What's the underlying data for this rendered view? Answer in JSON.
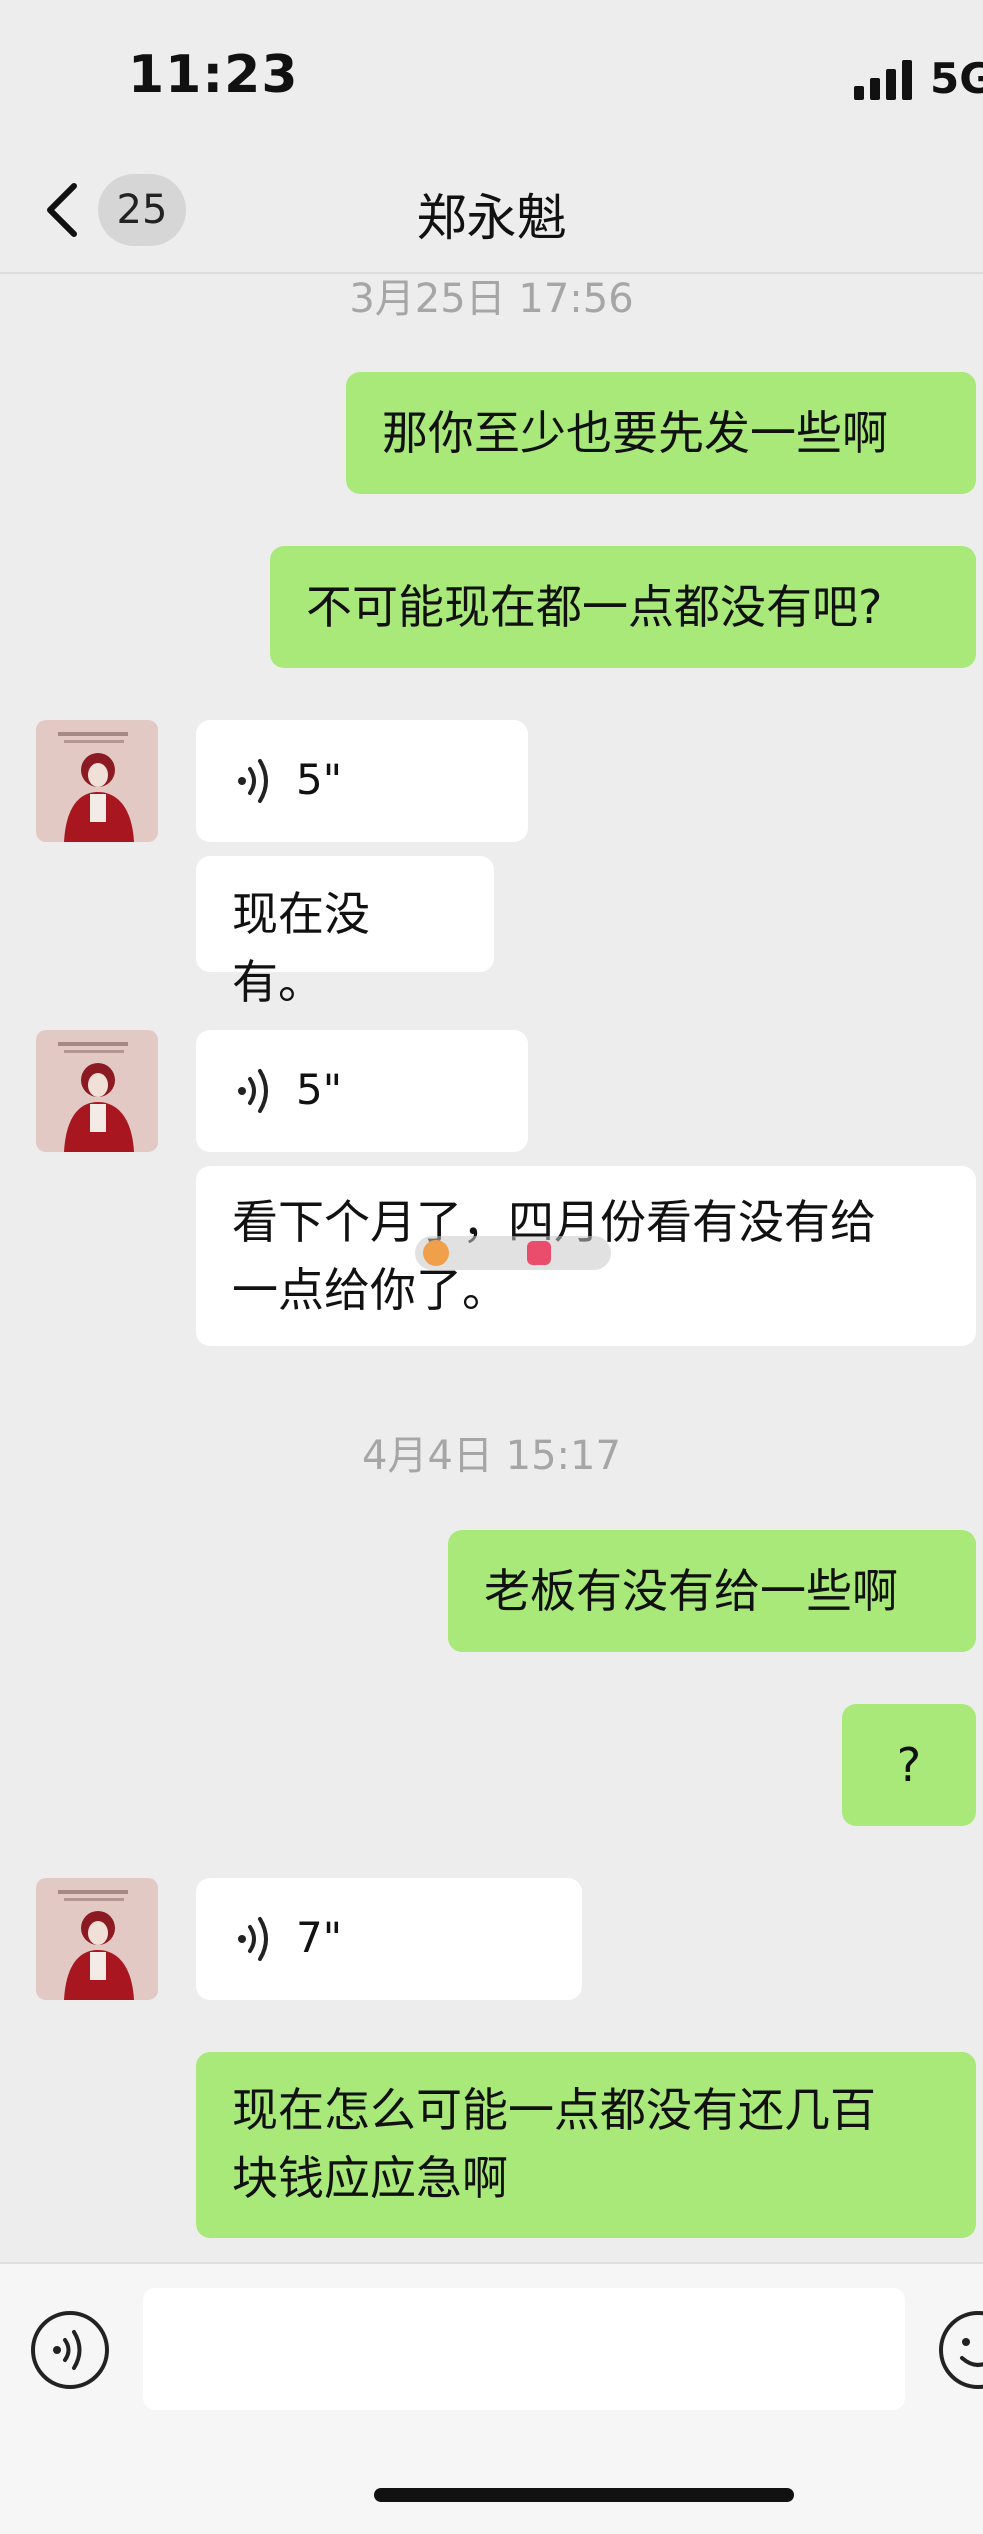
{
  "status_bar": {
    "time": "11:23",
    "network": "5G"
  },
  "nav": {
    "unread_count": "25",
    "title": "郑永魁"
  },
  "messages": [
    {
      "type": "timestamp",
      "text": "3月25日 17:56"
    },
    {
      "type": "text",
      "side": "out",
      "text": "那你至少也要先发一些啊"
    },
    {
      "type": "text",
      "side": "out",
      "text": "不可能现在都一点都没有吧?"
    },
    {
      "type": "voice",
      "side": "in",
      "duration": "5\""
    },
    {
      "type": "text",
      "side": "in",
      "text": "现在没有。"
    },
    {
      "type": "voice",
      "side": "in",
      "duration": "5\""
    },
    {
      "type": "text",
      "side": "in",
      "lines": [
        "看下个月了，四月份看有没有给",
        "一点给你了。"
      ]
    },
    {
      "type": "timestamp",
      "text": "4月4日 15:17"
    },
    {
      "type": "text",
      "side": "out",
      "text": "老板有没有给一些啊"
    },
    {
      "type": "text",
      "side": "out",
      "text": "?"
    },
    {
      "type": "voice",
      "side": "in",
      "duration": "7\""
    },
    {
      "type": "text",
      "side": "out",
      "lines": [
        "现在怎么可能一点都没有还几百",
        "块钱应应急啊"
      ]
    }
  ],
  "input": {
    "value": "",
    "placeholder": ""
  },
  "colors": {
    "background": "#ededed",
    "outgoing_bubble": "#a9e97a",
    "incoming_bubble": "#ffffff",
    "timestamp": "#a6a6a6"
  },
  "icons": {
    "back": "chevron-left-icon",
    "voice_message": "sound-wave-icon",
    "voice_toggle": "voice-mode-icon",
    "emoji": "emoji-icon"
  }
}
